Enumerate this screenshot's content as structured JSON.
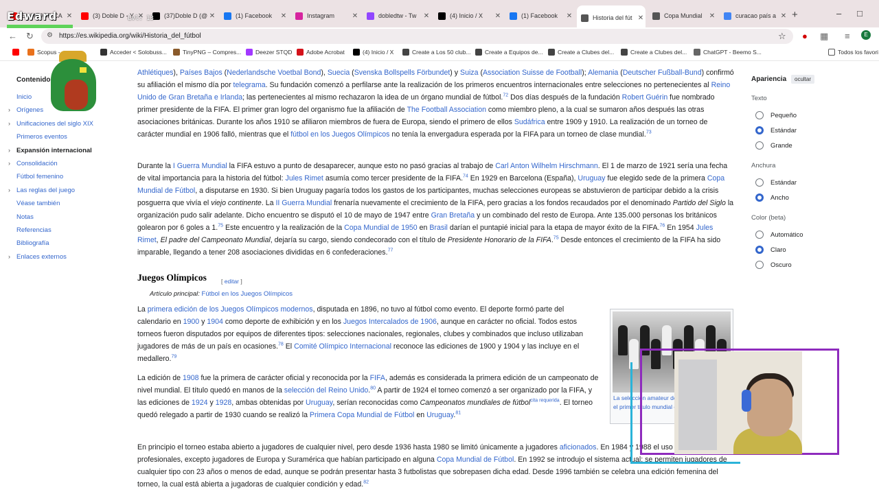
{
  "browser": {
    "tabs": [
      {
        "title": "EL MEJOR CA",
        "icon_color": "#ff0000"
      },
      {
        "title": "(3) Doble D - Y",
        "icon_color": "#ff0000"
      },
      {
        "title": "(37)Doble D (@",
        "icon_color": "#000000"
      },
      {
        "title": "(1) Facebook",
        "icon_color": "#1877f2"
      },
      {
        "title": "Instagram",
        "icon_color": "#d6249f"
      },
      {
        "title": "dobledtw - Tw",
        "icon_color": "#9146ff"
      },
      {
        "title": "(4) Inicio / X",
        "icon_color": "#000000"
      },
      {
        "title": "(1) Facebook",
        "icon_color": "#1877f2"
      },
      {
        "title": "Historia del fút",
        "icon_color": "#555555"
      },
      {
        "title": "Copa Mundial",
        "icon_color": "#555555"
      },
      {
        "title": "curacao país a",
        "icon_color": "#4285f4"
      }
    ],
    "active_tab_index": 8,
    "new_tab": "+",
    "url": "https://es.wikipedia.org/wiki/Historia_del_fútbol",
    "bookmarks": [
      {
        "label": "",
        "icon_color": "#ff0000"
      },
      {
        "label": "Scopus - ...",
        "icon_color": "#e9711c"
      },
      {
        "label": "Acceder < Solobuss...",
        "icon_color": "#333333"
      },
      {
        "label": "TinyPNG – Compres...",
        "icon_color": "#8a5a2b"
      },
      {
        "label": "Deezer STQD",
        "icon_color": "#a238ff"
      },
      {
        "label": "Adobe Acrobat",
        "icon_color": "#d4121a"
      },
      {
        "label": "(4) Inicio / X",
        "icon_color": "#000000"
      },
      {
        "label": "Create a Los 50 club...",
        "icon_color": "#444444"
      },
      {
        "label": "Create a Equipos de...",
        "icon_color": "#444444"
      },
      {
        "label": "Create a Clubes del...",
        "icon_color": "#444444"
      },
      {
        "label": "Create a Clubes del...",
        "icon_color": "#444444"
      },
      {
        "label": "ChatGPT - Beemo S...",
        "icon_color": "#666666"
      }
    ],
    "all_favorites": "Todos los favori"
  },
  "overlay": {
    "name": "Edward",
    "level": "Lvl: 13"
  },
  "toc": {
    "title": "Contenido",
    "items": [
      {
        "label": "Inicio",
        "expandable": false,
        "active": false
      },
      {
        "label": "Orígenes",
        "expandable": true,
        "active": false
      },
      {
        "label": "Unificaciones del siglo XIX",
        "expandable": true,
        "active": false
      },
      {
        "label": "Primeros eventos",
        "expandable": false,
        "active": false
      },
      {
        "label": "Expansión internacional",
        "expandable": true,
        "active": true
      },
      {
        "label": "Consolidación",
        "expandable": true,
        "active": false
      },
      {
        "label": "Fútbol femenino",
        "expandable": false,
        "active": false
      },
      {
        "label": "Las reglas del juego",
        "expandable": true,
        "active": false
      },
      {
        "label": "Véase también",
        "expandable": false,
        "active": false
      },
      {
        "label": "Notas",
        "expandable": false,
        "active": false
      },
      {
        "label": "Referencias",
        "expandable": false,
        "active": false
      },
      {
        "label": "Bibliografía",
        "expandable": false,
        "active": false
      },
      {
        "label": "Enlaces externos",
        "expandable": true,
        "active": false
      }
    ]
  },
  "article": {
    "section_heading": "Juegos Olímpicos",
    "edit_label": "editar",
    "hatnote_prefix": "Artículo principal:",
    "hatnote_link": "Fútbol en los Juegos Olímpicos",
    "image_caption": "La selección amateur del Reino Unido obtuvo el primer título mundial de selecciones"
  },
  "appearance": {
    "title": "Apariencia",
    "hide": "ocultar",
    "text_label": "Texto",
    "text_options": [
      "Pequeño",
      "Estándar",
      "Grande"
    ],
    "text_selected": 1,
    "width_label": "Anchura",
    "width_options": [
      "Estándar",
      "Ancho"
    ],
    "width_selected": 1,
    "color_label": "Color (beta)",
    "color_options": [
      "Automático",
      "Claro",
      "Oscuro"
    ],
    "color_selected": 1
  }
}
